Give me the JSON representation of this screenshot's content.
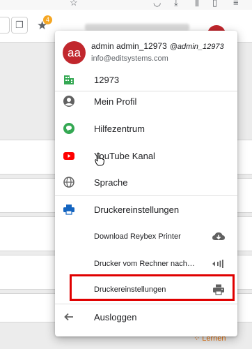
{
  "header": {
    "badge_count": "4",
    "avatar_initials": "aa"
  },
  "menu": {
    "user": {
      "initials": "aa",
      "name": "admin admin_12973",
      "handle": "@admin_12973",
      "email": "info@editsystems.com"
    },
    "org_id": "12973",
    "items": [
      {
        "label": "Mein Profil",
        "icon": "account-circle-icon"
      },
      {
        "label": "Hilfezentrum",
        "icon": "help-chat-icon"
      },
      {
        "label": "YouTube Kanal",
        "icon": "youtube-icon"
      },
      {
        "label": "Sprache",
        "icon": "globe-icon"
      }
    ],
    "printer_section": {
      "label": "Druckereinstellungen",
      "icon": "printer-icon",
      "sub_items": [
        {
          "label": "Download Reybex Printer",
          "icon": "cloud-download-icon"
        },
        {
          "label": "Drucker vom Rechner nach…",
          "icon": "signal-icon"
        },
        {
          "label": "Druckereinstellungen",
          "icon": "printer-settings-icon"
        }
      ]
    },
    "logout_label": "Ausloggen"
  },
  "background": {
    "lernen_label": "Lernen"
  },
  "colors": {
    "avatar": "#c1272d",
    "highlight": "#e00000",
    "org_icon": "#34a853",
    "help_icon": "#34a853",
    "youtube": "#ff0000",
    "printer_icon": "#1565c0"
  }
}
